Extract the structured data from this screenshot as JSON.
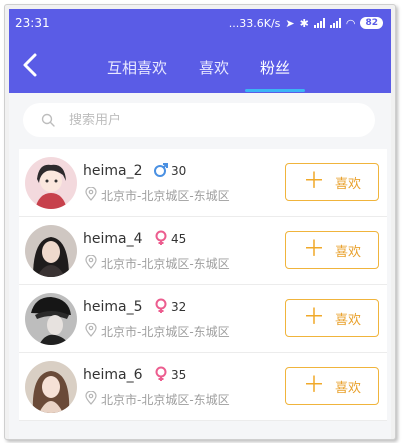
{
  "status": {
    "time": "23:31",
    "speed": "...33.6K/s",
    "battery": "82"
  },
  "nav": {
    "tabs": [
      {
        "label": "互相喜欢"
      },
      {
        "label": "喜欢"
      },
      {
        "label": "粉丝",
        "active": true
      }
    ]
  },
  "search": {
    "placeholder": "搜索用户",
    "value": ""
  },
  "users": [
    {
      "name": "heima_2",
      "age": "30",
      "gender": "male",
      "location": "北京市-北京城区-东城区",
      "button": "喜欢"
    },
    {
      "name": "heima_4",
      "age": "45",
      "gender": "female",
      "location": "北京市-北京城区-东城区",
      "button": "喜欢"
    },
    {
      "name": "heima_5",
      "age": "32",
      "gender": "female",
      "location": "北京市-北京城区-东城区",
      "button": "喜欢"
    },
    {
      "name": "heima_6",
      "age": "35",
      "gender": "female",
      "location": "北京市-北京城区-东城区",
      "button": "喜欢"
    }
  ],
  "colors": {
    "header": "#5a5ce6",
    "accent": "#f0b43c",
    "male": "#4a90e2",
    "female": "#ec5d8f"
  }
}
